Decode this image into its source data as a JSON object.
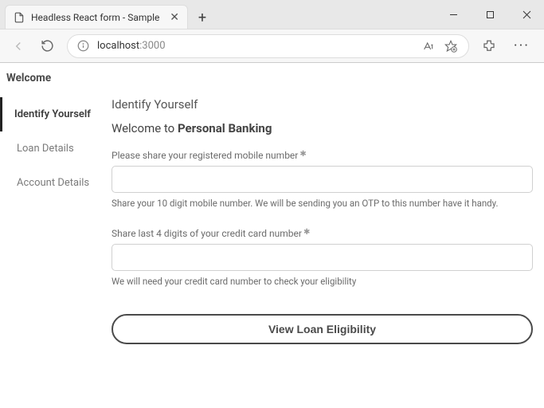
{
  "browser": {
    "tab_title": "Headless React form - Sample",
    "url_host": "localhost",
    "url_port": ":3000"
  },
  "page": {
    "header": "Welcome",
    "sidebar": {
      "items": [
        {
          "label": "Identify Yourself",
          "active": true
        },
        {
          "label": "Loan Details",
          "active": false
        },
        {
          "label": "Account Details",
          "active": false
        }
      ]
    },
    "main": {
      "title": "Identify Yourself",
      "welcome_prefix": "Welcome to ",
      "welcome_bold": "Personal Banking",
      "fields": [
        {
          "label": "Please share your registered mobile number",
          "required": true,
          "value": "",
          "help": "Share your 10 digit mobile number. We will be sending you an OTP to this number have it handy."
        },
        {
          "label": "Share last 4 digits of your credit card number",
          "required": true,
          "value": "",
          "help": "We will need your credit card number to check your eligibility"
        }
      ],
      "submit_label": "View Loan Eligibility"
    }
  }
}
